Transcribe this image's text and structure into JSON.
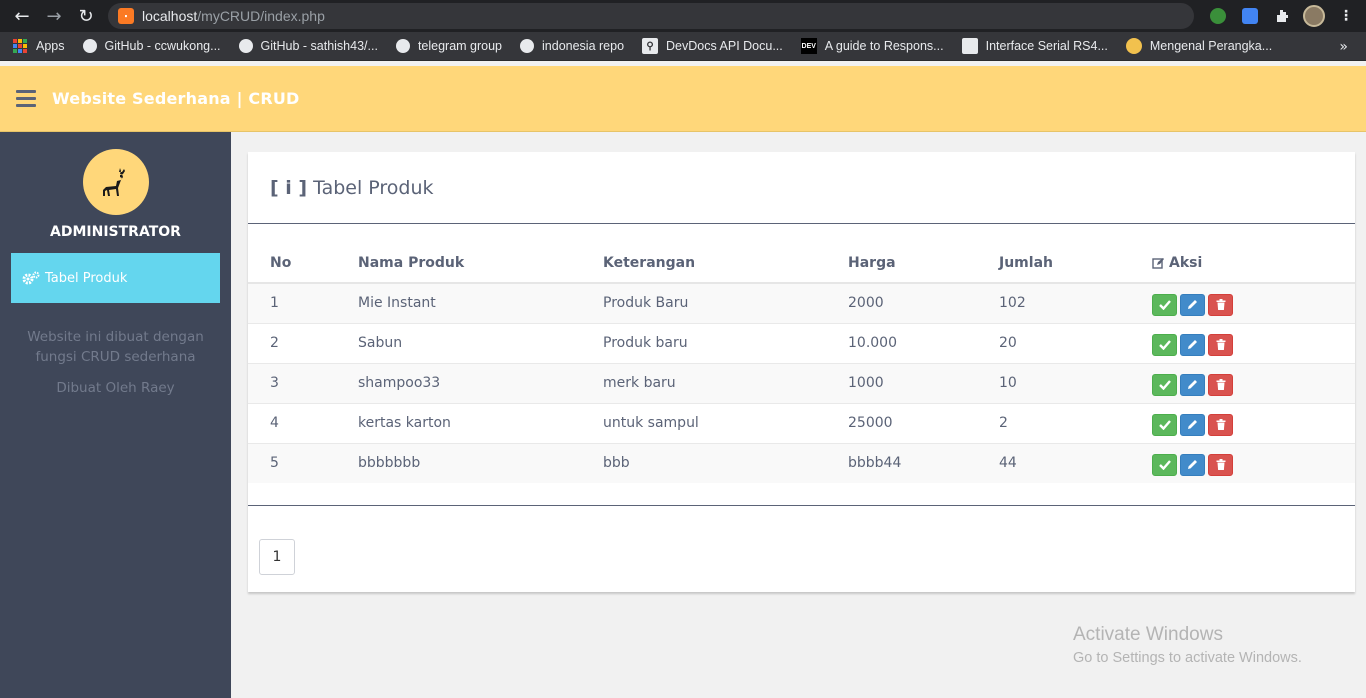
{
  "browser": {
    "url_host": "localhost",
    "url_path": "/myCRUD/index.php",
    "bookmarks": [
      {
        "label": "Apps"
      },
      {
        "label": "GitHub - ccwukong..."
      },
      {
        "label": "GitHub - sathish43/..."
      },
      {
        "label": "telegram group"
      },
      {
        "label": "indonesia repo"
      },
      {
        "label": "DevDocs API Docu..."
      },
      {
        "label": "A guide to Respons..."
      },
      {
        "label": "Interface Serial RS4..."
      },
      {
        "label": "Mengenal Perangka..."
      }
    ],
    "more": "»"
  },
  "header": {
    "brand": "Website Sederhana | CRUD"
  },
  "sidebar": {
    "role": "ADMINISTRATOR",
    "menu_item": "Tabel Produk",
    "note_line1": "Website ini dibuat dengan",
    "note_line2": "fungsi CRUD sederhana",
    "author": "Dibuat Oleh Raey"
  },
  "card": {
    "title_icon": "[ i ]",
    "title": "Tabel Produk",
    "columns": [
      "No",
      "Nama Produk",
      "Keterangan",
      "Harga",
      "Jumlah",
      "Aksi"
    ],
    "rows": [
      {
        "no": "1",
        "nama": "Mie Instant",
        "ket": "Produk Baru",
        "harga": "2000",
        "jumlah": "102"
      },
      {
        "no": "2",
        "nama": "Sabun",
        "ket": "Produk baru",
        "harga": "10.000",
        "jumlah": "20"
      },
      {
        "no": "3",
        "nama": "shampoo33",
        "ket": "merk baru",
        "harga": "1000",
        "jumlah": "10"
      },
      {
        "no": "4",
        "nama": "kertas karton",
        "ket": "untuk sampul",
        "harga": "25000",
        "jumlah": "2"
      },
      {
        "no": "5",
        "nama": "bbbbbbb",
        "ket": "bbb",
        "harga": "bbbb44",
        "jumlah": "44"
      }
    ],
    "page": "1"
  },
  "watermark": {
    "title": "Activate Windows",
    "subtitle": "Go to Settings to activate Windows."
  },
  "colors": {
    "header": "#ffd77a",
    "sidebar": "#3f4759",
    "active_menu": "#64d6ee",
    "btn_success": "#5cb85c",
    "btn_primary": "#428bca",
    "btn_danger": "#d9534f"
  }
}
